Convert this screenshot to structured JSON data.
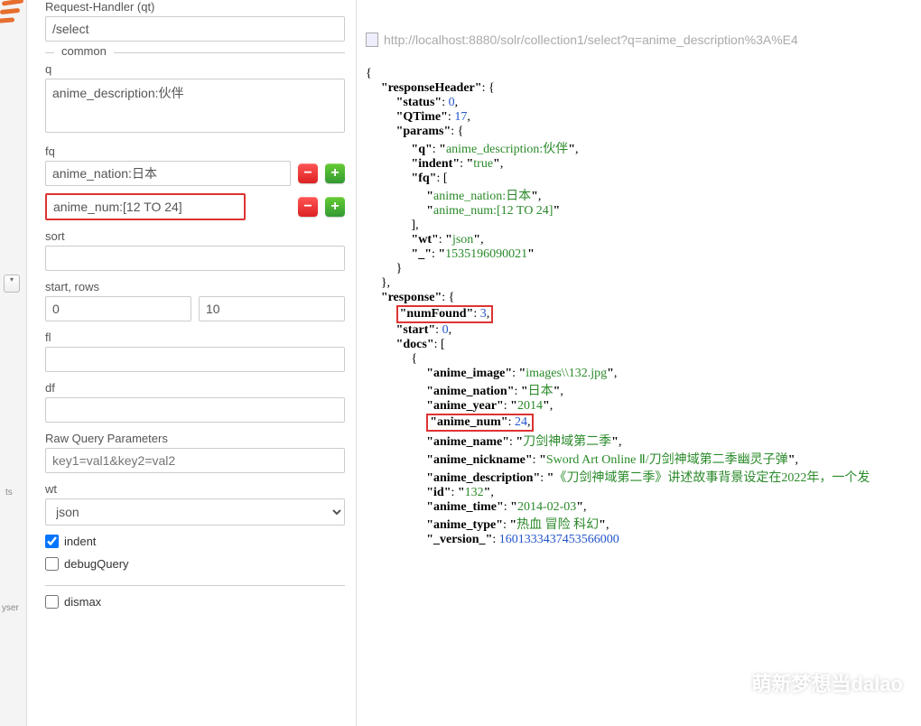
{
  "form": {
    "requestHandler": {
      "label": "Request-Handler (qt)",
      "value": "/select"
    },
    "sectionCommon": "common",
    "q": {
      "label": "q",
      "value": "anime_description:伙伴"
    },
    "fq": {
      "label": "fq",
      "rows": [
        {
          "value": "anime_nation:日本",
          "highlight": false
        },
        {
          "value": "anime_num:[12 TO 24]",
          "highlight": true
        }
      ]
    },
    "sort": {
      "label": "sort",
      "value": ""
    },
    "startRows": {
      "label": "start, rows",
      "start": "0",
      "rows": "10"
    },
    "fl": {
      "label": "fl",
      "value": ""
    },
    "df": {
      "label": "df",
      "value": ""
    },
    "rawQuery": {
      "label": "Raw Query Parameters",
      "placeholder": "key1=val1&key2=val2"
    },
    "wt": {
      "label": "wt",
      "value": "json"
    },
    "indent": {
      "label": "indent",
      "checked": true
    },
    "debugQuery": {
      "label": "debugQuery",
      "checked": false
    },
    "dismax": {
      "label": "dismax",
      "checked": false
    }
  },
  "sidebar": {
    "item1": "ts",
    "item2": "yser"
  },
  "urlBar": "http://localhost:8880/solr/collection1/select?q=anime_description%3A%E4",
  "response": {
    "l1": "{",
    "responseHeader": "responseHeader",
    "status_k": "status",
    "status_v": "0",
    "qtime_k": "QTime",
    "qtime_v": "17",
    "params_k": "params",
    "p_q_k": "q",
    "p_q_v": "anime_description:伙伴",
    "p_indent_k": "indent",
    "p_indent_v": "true",
    "p_fq_k": "fq",
    "p_fq_v1": "anime_nation:日本",
    "p_fq_v2": "anime_num:[12 TO 24]",
    "p_wt_k": "wt",
    "p_wt_v": "json",
    "p_us_k": "_",
    "p_us_v": "1535196090021",
    "response_k": "response",
    "numFound_k": "numFound",
    "numFound_v": "3",
    "start_k": "start",
    "start_v": "0",
    "docs_k": "docs",
    "d_image_k": "anime_image",
    "d_image_v": "images\\\\132.jpg",
    "d_nation_k": "anime_nation",
    "d_nation_v": "日本",
    "d_year_k": "anime_year",
    "d_year_v": "2014",
    "d_num_k": "anime_num",
    "d_num_v": "24",
    "d_name_k": "anime_name",
    "d_name_v": "刀剑神域第二季",
    "d_nick_k": "anime_nickname",
    "d_nick_v": "Sword Art Online Ⅱ/刀剑神域第二季幽灵子弹",
    "d_desc_k": "anime_description",
    "d_desc_v": "《刀剑神域第二季》讲述故事背景设定在2022年，一个发",
    "d_id_k": "id",
    "d_id_v": "132",
    "d_time_k": "anime_time",
    "d_time_v": "2014-02-03",
    "d_type_k": "anime_type",
    "d_type_v": "热血 冒险 科幻",
    "d_ver_k": "_version_",
    "d_ver_v": "1601333437453566000"
  },
  "watermark": "萌新梦想当dalao"
}
